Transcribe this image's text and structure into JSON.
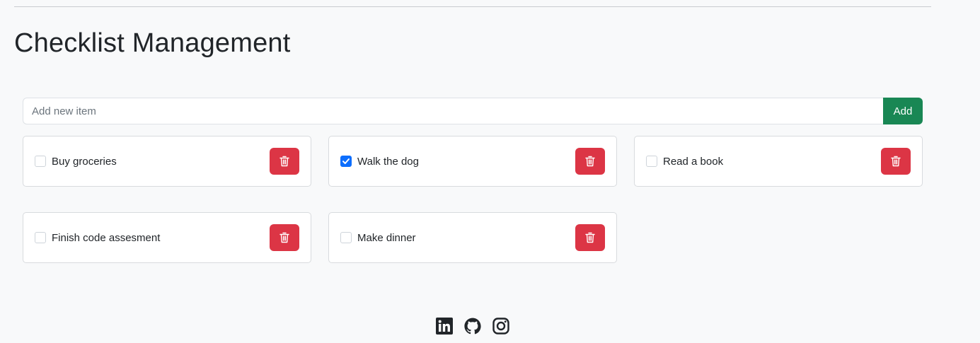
{
  "page": {
    "title": "Checklist Management"
  },
  "add_form": {
    "placeholder": "Add new item",
    "value": "",
    "button_label": "Add"
  },
  "items": [
    {
      "label": "Buy groceries",
      "checked": false
    },
    {
      "label": "Walk the dog",
      "checked": true
    },
    {
      "label": "Read a book",
      "checked": false
    },
    {
      "label": "Finish code assesment",
      "checked": false
    },
    {
      "label": "Make dinner",
      "checked": false
    }
  ],
  "item_actions": {
    "delete_icon": "trash-icon"
  },
  "footer": {
    "social_icons": [
      "linkedin-icon",
      "github-icon",
      "instagram-icon"
    ]
  },
  "colors": {
    "background": "#f8f9fa",
    "add_button": "#198754",
    "delete_button": "#dc3545",
    "checkbox_checked": "#0d6efd"
  }
}
